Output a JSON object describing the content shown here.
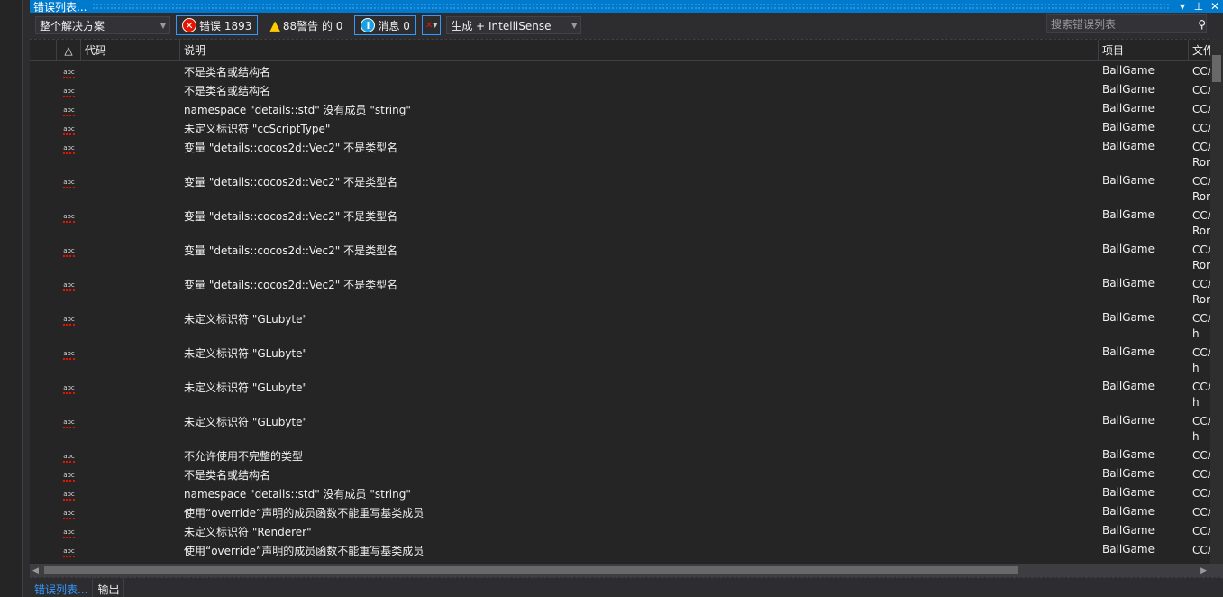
{
  "window": {
    "title": "错误列表...",
    "controls": [
      "▾",
      "⊥",
      "✕"
    ]
  },
  "toolbar": {
    "scope": "整个解决方案",
    "errors": "错误 1893",
    "warnings": "88警告 的 0",
    "messages": "消息 0",
    "source": "生成 + IntelliSense",
    "search_placeholder": "搜索错误列表"
  },
  "columns": {
    "code": "代码",
    "desc": "说明",
    "project": "项目",
    "file": "文件"
  },
  "rows": [
    {
      "desc": "不是类名或结构名",
      "project": "BallGame",
      "file": "CCA"
    },
    {
      "desc": "不是类名或结构名",
      "project": "BallGame",
      "file": "CCA"
    },
    {
      "desc": "namespace \"details::std\" 没有成员 \"string\"",
      "project": "BallGame",
      "file": "CCA"
    },
    {
      "desc": "未定义标识符 \"ccScriptType\"",
      "project": "BallGame",
      "file": "CCA"
    },
    {
      "desc": "变量 \"details::cocos2d::Vec2\" 不是类型名",
      "project": "BallGame",
      "file": "CCA",
      "file2": "Rom"
    },
    {
      "desc": "变量 \"details::cocos2d::Vec2\" 不是类型名",
      "project": "BallGame",
      "file": "CCA",
      "file2": "Rom"
    },
    {
      "desc": "变量 \"details::cocos2d::Vec2\" 不是类型名",
      "project": "BallGame",
      "file": "CCA",
      "file2": "Rom"
    },
    {
      "desc": "变量 \"details::cocos2d::Vec2\" 不是类型名",
      "project": "BallGame",
      "file": "CCA",
      "file2": "Rom"
    },
    {
      "desc": "变量 \"details::cocos2d::Vec2\" 不是类型名",
      "project": "BallGame",
      "file": "CCA",
      "file2": "Rom"
    },
    {
      "desc": "未定义标识符 \"GLubyte\"",
      "project": "BallGame",
      "file": "CCA",
      "file2": "h"
    },
    {
      "desc": "未定义标识符 \"GLubyte\"",
      "project": "BallGame",
      "file": "CCA",
      "file2": "h"
    },
    {
      "desc": "未定义标识符 \"GLubyte\"",
      "project": "BallGame",
      "file": "CCA",
      "file2": "h"
    },
    {
      "desc": "未定义标识符 \"GLubyte\"",
      "project": "BallGame",
      "file": "CCA",
      "file2": "h"
    },
    {
      "desc": "不允许使用不完整的类型",
      "project": "BallGame",
      "file": "CCA"
    },
    {
      "desc": "不是类名或结构名",
      "project": "BallGame",
      "file": "CCA"
    },
    {
      "desc": "namespace \"details::std\" 没有成员 \"string\"",
      "project": "BallGame",
      "file": "CCA"
    },
    {
      "desc": "使用“override”声明的成员函数不能重写基类成员",
      "project": "BallGame",
      "file": "CCA"
    },
    {
      "desc": "未定义标识符 \"Renderer\"",
      "project": "BallGame",
      "file": "CCA"
    },
    {
      "desc": "使用“override”声明的成员函数不能重写基类成员",
      "project": "BallGame",
      "file": "CCA"
    }
  ],
  "icon_label": "abc",
  "tabs": [
    "错误列表...",
    "输出"
  ],
  "colors": {
    "accent": "#007acc",
    "error": "#e51400",
    "warning": "#ffcc00",
    "info": "#1ba1e2"
  }
}
